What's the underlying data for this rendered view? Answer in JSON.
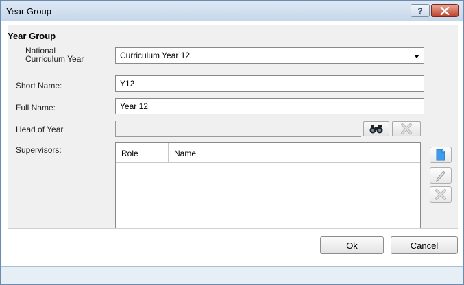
{
  "window": {
    "title": "Year Group",
    "help_glyph": "?",
    "close_icon": "close-icon"
  },
  "form": {
    "section_title": "Year Group",
    "national_label_line1": "National",
    "national_label_line2": "Curriculum Year",
    "national_value": "Curriculum Year 12",
    "short_name_label": "Short Name:",
    "short_name_value": "Y12",
    "full_name_label": "Full Name:",
    "full_name_value": "Year 12",
    "head_of_year_label": "Head of Year",
    "head_of_year_value": "",
    "supervisors_label": "Supervisors:"
  },
  "supervisors_grid": {
    "columns": [
      "Role",
      "Name",
      ""
    ],
    "rows": []
  },
  "buttons": {
    "ok": "Ok",
    "cancel": "Cancel"
  },
  "colors": {
    "title_gradient_top": "#dfe9f5",
    "close_red": "#c0432b",
    "panel_bg": "#f0f0f0",
    "new_icon_blue": "#1e78c8"
  }
}
